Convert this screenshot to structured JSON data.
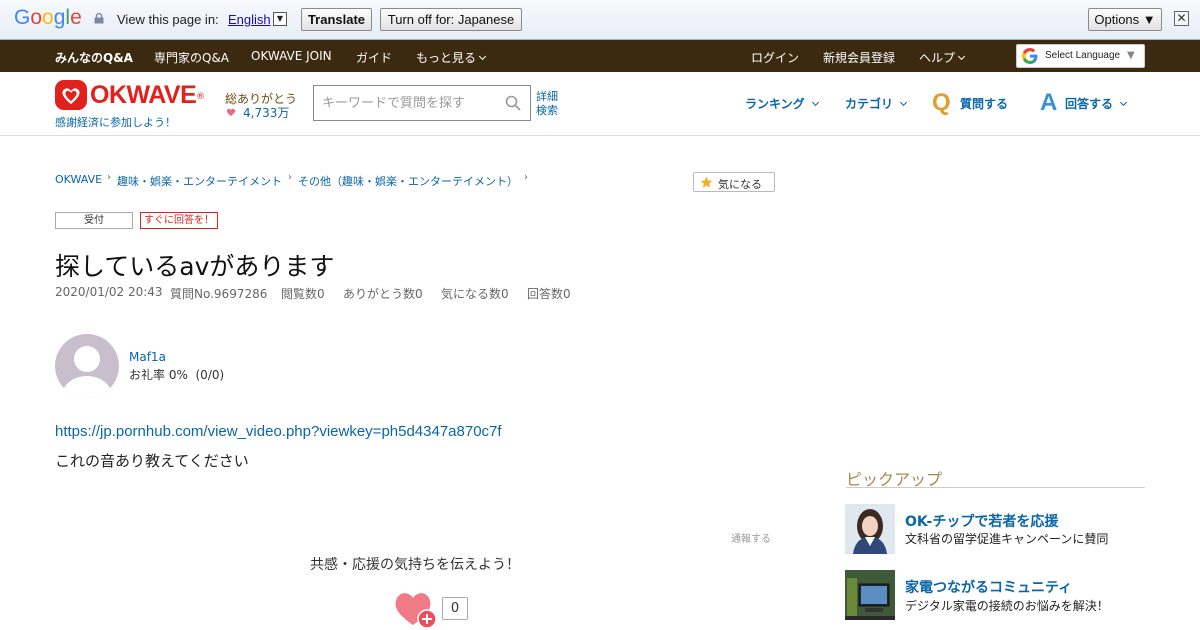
{
  "translate_bar": {
    "logo_letters": [
      "G",
      "o",
      "o",
      "g",
      "l",
      "e"
    ],
    "logo_colors": [
      "#4285f4",
      "#ea4335",
      "#fbbc05",
      "#4285f4",
      "#34a853",
      "#ea4335"
    ],
    "view_text": "View this page in:",
    "language": "English",
    "translate_label": "Translate",
    "turn_off_label": "Turn off for: Japanese",
    "options_label": "Options ▼",
    "close_label": "✕"
  },
  "nav": {
    "items": [
      {
        "label": "みんなのQ&A"
      },
      {
        "label": "専門家のQ&A"
      },
      {
        "label": "OKWAVE JOIN"
      },
      {
        "label": "ガイド"
      },
      {
        "label": "もっと見る"
      },
      {
        "label": "ログイン"
      },
      {
        "label": "新規会員登録"
      },
      {
        "label": "ヘルプ"
      }
    ],
    "select_language": "Select Language",
    "select_language_arrow": "▼"
  },
  "header": {
    "logo_text": "OKWAVE",
    "logo_mark": "®",
    "tagline": "感謝経済に参加しよう！",
    "thanks_label": "総ありがとう",
    "thanks_count": "4,733万",
    "search_placeholder": "キーワードで質問を探す",
    "advanced_search": "詳細検索",
    "ranking": "ランキング",
    "category": "カテゴリ",
    "ask_letter": "Q",
    "ask": "質問する",
    "answer_letter": "A",
    "answer": "回答する"
  },
  "breadcrumb": {
    "items": [
      "OKWAVE",
      "趣味・娯楽・エンターテイメント",
      "その他（趣味・娯楽・エンターテイメント）"
    ],
    "sep": "›"
  },
  "question": {
    "watch_label": "気になる",
    "status_badge": "受付",
    "urgent_badge": "すぐに回答を！",
    "title": "探しているavがあります",
    "date": "2020/01/02 20:43",
    "number": "質問No.9697286",
    "views": "閲覧数0",
    "thanks": "ありがとう数0",
    "watch_count": "気になる数0",
    "answers": "回答数0",
    "user_name": "Maf1a",
    "reward_rate": "お礼率 0%",
    "reward_detail": "(0/0)",
    "link": "https://jp.pornhub.com/view_video.php?viewkey=ph5d4347a870c7f",
    "body": "これの音あり教えてください",
    "report": "通報する",
    "empathy": "共感・応援の気持ちを伝えよう！",
    "empathy_count": "0"
  },
  "pickup": {
    "title": "ピックアップ",
    "items": [
      {
        "headline": "OK-チップで若者を応援",
        "sub": "文科省の留学促進キャンペーンに賛同"
      },
      {
        "headline": "家電つながるコミュニティ",
        "sub": "デジタル家電の接続のお悩みを解決！"
      }
    ]
  },
  "colors": {
    "brand_red": "#e2211c",
    "nav_brown": "#3b2a10",
    "link_blue": "#0a66a8",
    "accent_gold": "#e0a030",
    "pickup_gold": "#a38a55"
  }
}
